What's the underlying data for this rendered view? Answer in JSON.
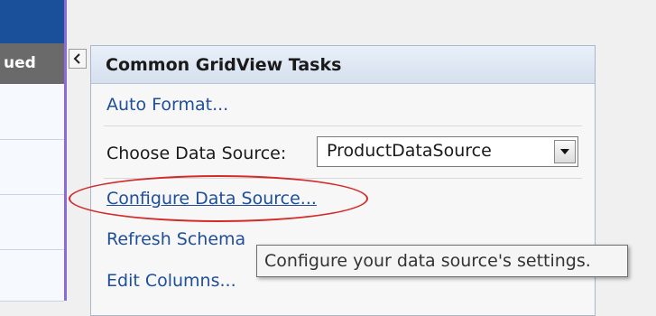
{
  "grid": {
    "header_text": "ued"
  },
  "panel": {
    "collapse_icon": "chevron-left-icon",
    "title": "Common GridView Tasks",
    "auto_format": "Auto Format...",
    "choose_data_source_label": "Choose Data Source:",
    "data_source_value": "ProductDataSource",
    "configure_data_source": "Configure Data Source...",
    "refresh_schema": "Refresh Schema",
    "edit_columns": "Edit Columns..."
  },
  "tooltip": {
    "text": "Configure your data source's settings."
  },
  "colors": {
    "grid_top": "#1a4f9a",
    "grid_header": "#6a6a6a",
    "link": "#1f4e9a",
    "highlight": "#d42a2a"
  }
}
